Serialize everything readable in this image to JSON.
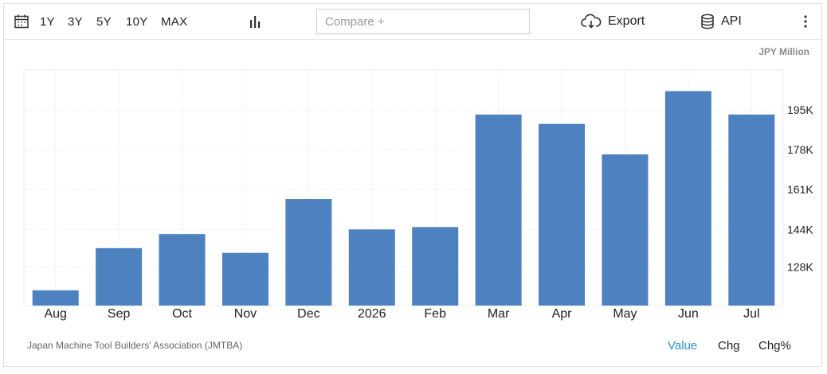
{
  "toolbar": {
    "ranges": [
      "1Y",
      "3Y",
      "5Y",
      "10Y",
      "MAX"
    ],
    "calendar_icon": "calendar-icon",
    "chart_type_icon": "bar-chart-icon",
    "compare_placeholder": "Compare +",
    "export_label": "Export",
    "export_icon": "cloud-download-icon",
    "api_label": "API",
    "api_icon": "database-icon",
    "more_icon": "more-vertical-icon"
  },
  "unit_label": "JPY Million",
  "source": "Japan Machine Tool Builders' Association (JMTBA)",
  "view_tabs": {
    "value": "Value",
    "chg": "Chg",
    "chg_pct": "Chg%",
    "active": "value"
  },
  "colors": {
    "bar": "#4d81bf",
    "active_tab": "#2a8fd6",
    "grid": "#ebebeb"
  },
  "chart_data": {
    "type": "bar",
    "categories": [
      "Aug",
      "Sep",
      "Oct",
      "Nov",
      "Dec",
      "2026",
      "Feb",
      "Mar",
      "Apr",
      "May",
      "Jun",
      "Jul"
    ],
    "values": [
      118,
      136,
      142,
      134,
      157,
      144,
      145,
      193,
      189,
      176,
      203,
      193
    ],
    "ylim": [
      111.5,
      212
    ],
    "yticks": [
      128,
      144,
      161,
      178,
      195
    ],
    "ytick_labels": [
      "128K",
      "144K",
      "161K",
      "178K",
      "195K"
    ],
    "y_axis_side": "right",
    "grid": true,
    "title": "",
    "xlabel": "",
    "ylabel": ""
  }
}
